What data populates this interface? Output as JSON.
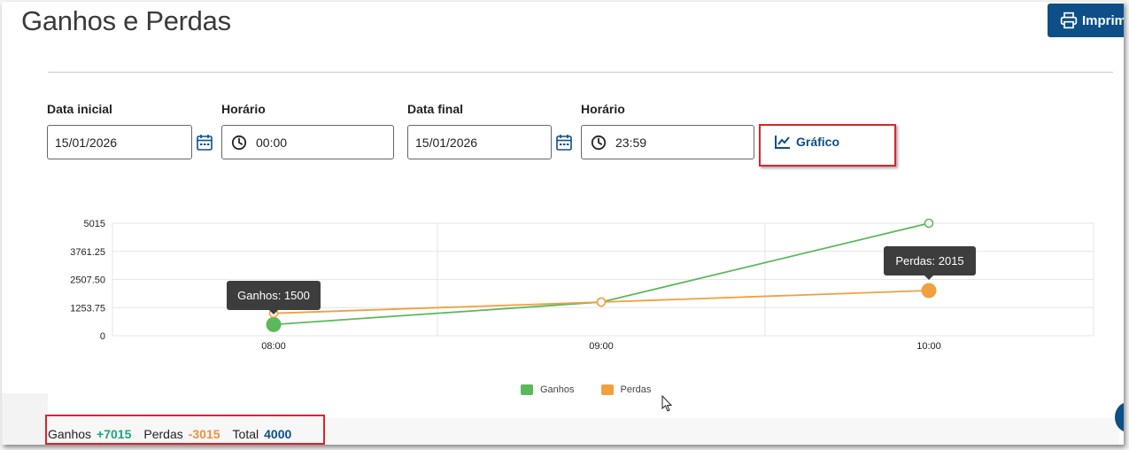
{
  "page": {
    "title": "Ganhos e Perdas",
    "print_label": "Imprim"
  },
  "filters": {
    "start_date": {
      "label": "Data inicial",
      "value": "15/01/2026"
    },
    "start_time": {
      "label": "Horário",
      "value": "00:00"
    },
    "end_date": {
      "label": "Data final",
      "value": "15/01/2026"
    },
    "end_time": {
      "label": "Horário",
      "value": "23:59"
    },
    "chart_button": "Gráfico"
  },
  "chart_data": {
    "type": "line",
    "categories": [
      "08:00",
      "09:00",
      "10:00"
    ],
    "y_ticks": [
      "5015",
      "3761.25",
      "2507.50",
      "1253.75",
      "0"
    ],
    "ylim": [
      0,
      5015
    ],
    "grid": true,
    "legend": "bottom",
    "series": [
      {
        "name": "Ganhos",
        "values": [
          500,
          1500,
          5015
        ],
        "color": "#5cb85c"
      },
      {
        "name": "Perdas",
        "values": [
          1000,
          1500,
          2015
        ],
        "color": "#f0a040"
      }
    ],
    "tooltips": [
      {
        "text": "Ganhos: 1500"
      },
      {
        "text": "Perdas: 2015"
      }
    ]
  },
  "summary": {
    "gains_label": "Ganhos",
    "gains_value": "+7015",
    "gains_color": "#1aa77a",
    "losses_label": "Perdas",
    "losses_value": "-3015",
    "losses_color": "#f0903a",
    "total_label": "Total",
    "total_value": "4000",
    "total_color": "#0d4f86"
  }
}
